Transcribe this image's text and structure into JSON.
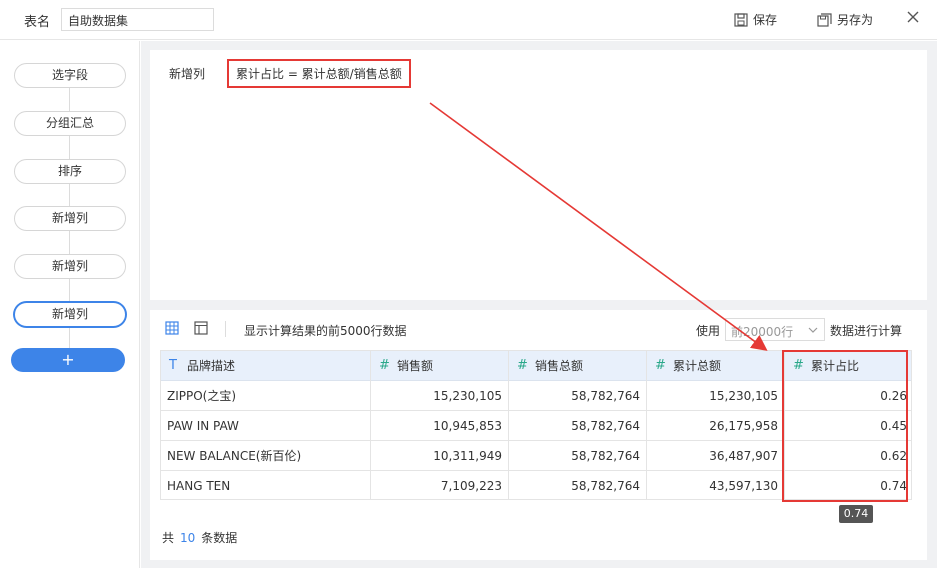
{
  "topbar": {
    "table_name_label": "表名",
    "table_name_value": "自助数据集",
    "save_label": "保存",
    "save_as_label": "另存为"
  },
  "steps": [
    "选字段",
    "分组汇总",
    "排序",
    "新增列",
    "新增列",
    "新增列"
  ],
  "add_step_label": "+",
  "formula": {
    "label": "新增列",
    "expression": "累计占比 = 累计总额/销售总额"
  },
  "result": {
    "hint": "显示计算结果的前5000行数据",
    "use_label": "使用",
    "row_select_value": "前20000行",
    "tail_label": "数据进行计算",
    "columns": [
      {
        "type_icon": "T",
        "label": "品牌描述"
      },
      {
        "type_icon": "#",
        "label": "销售额"
      },
      {
        "type_icon": "#",
        "label": "销售总额"
      },
      {
        "type_icon": "#",
        "label": "累计总额"
      },
      {
        "type_icon": "#",
        "label": "累计占比"
      }
    ],
    "rows": [
      [
        "ZIPPO(之宝)",
        "15,230,105",
        "58,782,764",
        "15,230,105",
        "0.26"
      ],
      [
        "PAW IN PAW",
        "10,945,853",
        "58,782,764",
        "26,175,958",
        "0.45"
      ],
      [
        "NEW BALANCE(新百伦)",
        "10,311,949",
        "58,782,764",
        "36,487,907",
        "0.62"
      ],
      [
        "HANG TEN",
        "7,109,223",
        "58,782,764",
        "43,597,130",
        "0.74"
      ]
    ],
    "tooltip": "0.74",
    "footer_prefix": "共",
    "footer_count": "10",
    "footer_suffix": "条数据"
  },
  "colors": {
    "accent": "#3d84e8",
    "annotation": "#e53935",
    "header_bg": "#e8f0fb",
    "type_icon": "#2aa88a"
  }
}
